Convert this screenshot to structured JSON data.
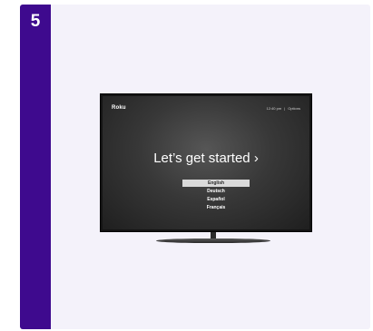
{
  "step": {
    "number": "5"
  },
  "tv_screen": {
    "brand": "Roku",
    "time": "12:40 pm",
    "separator": "|",
    "options_label": "Options",
    "headline": "Let’s get started ›",
    "languages": [
      {
        "label": "English",
        "selected": true
      },
      {
        "label": "Deutsch",
        "selected": false
      },
      {
        "label": "Español",
        "selected": false
      },
      {
        "label": "Français",
        "selected": false
      }
    ]
  },
  "colors": {
    "accent": "#3e0a8e",
    "card_background": "#f4f2fa",
    "tv_body": "#141414",
    "selection_highlight": "#dadada"
  }
}
